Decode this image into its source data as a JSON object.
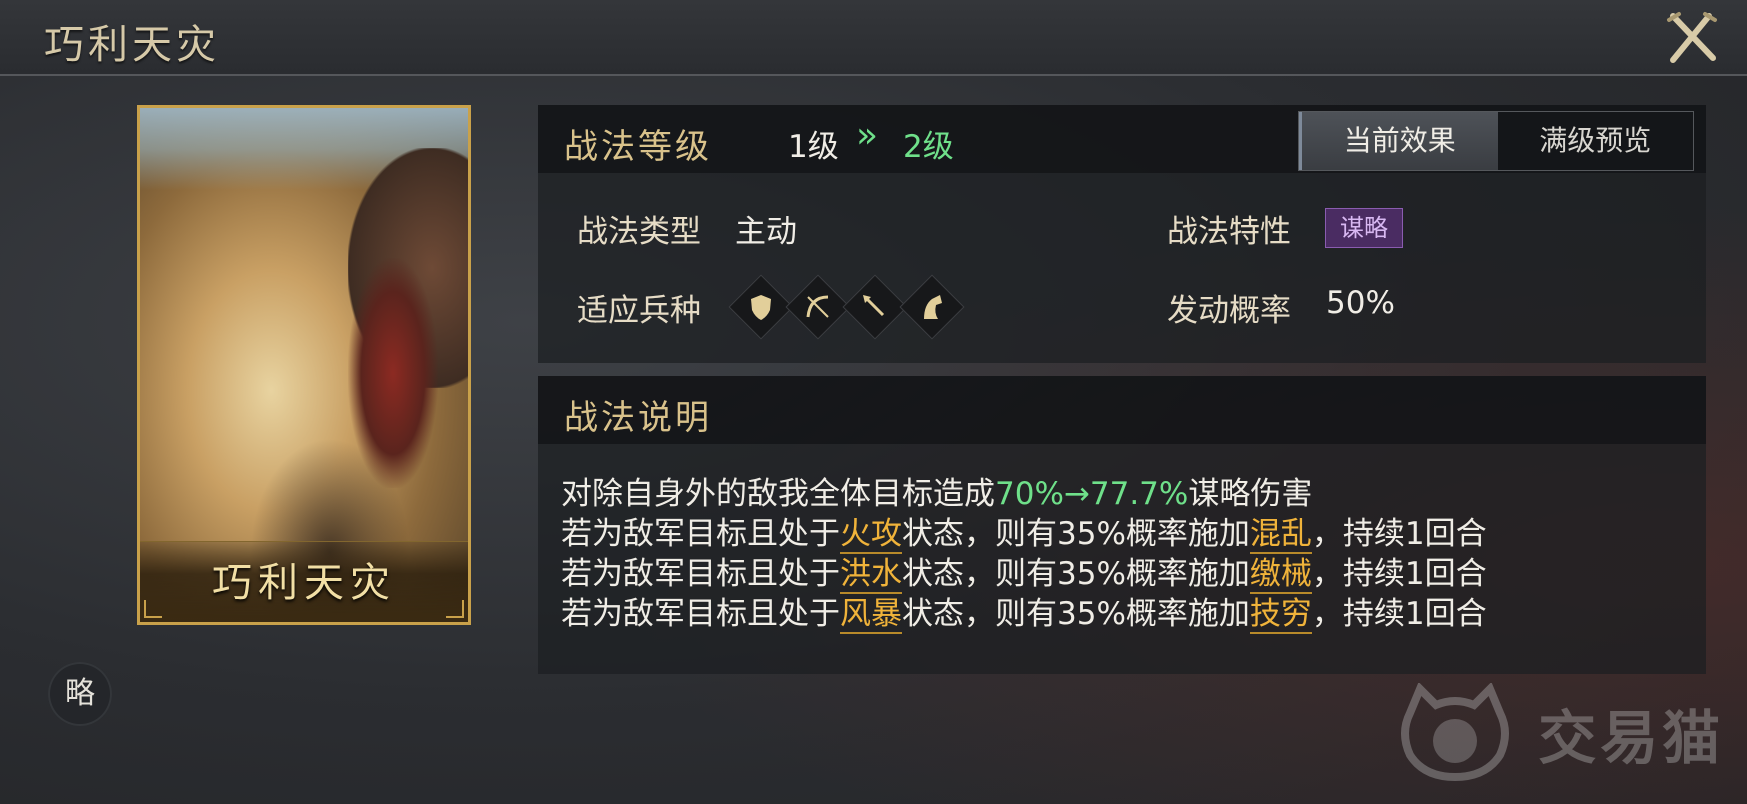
{
  "header": {
    "title": "巧利天灾"
  },
  "card": {
    "name": "巧利天灾"
  },
  "badge": {
    "text": "略"
  },
  "level_panel": {
    "title": "战法等级",
    "current_level": "1级",
    "arrow": "»",
    "next_level": "2级",
    "tabs": [
      {
        "label": "当前效果",
        "active": true
      },
      {
        "label": "满级预览",
        "active": false
      }
    ]
  },
  "info": {
    "type_label": "战法类型",
    "type_value": "主动",
    "trait_label": "战法特性",
    "trait_value": "谋略",
    "troop_label": "适应兵种",
    "troops": [
      "shield-icon",
      "bow-icon",
      "spear-icon",
      "horse-icon"
    ],
    "rate_label": "发动概率",
    "rate_value": "50%"
  },
  "description": {
    "title": "战法说明",
    "line1": {
      "prefix": "对除自身外的敌我全体目标造成",
      "value": "70%→77.7%",
      "suffix": "谋略伤害"
    },
    "lines": [
      {
        "prefix": "若为敌军目标且处于",
        "state": "火攻",
        "middle": "状态，则有35%概率施加",
        "effect": "混乱",
        "suffix": "，持续1回合"
      },
      {
        "prefix": "若为敌军目标且处于",
        "state": "洪水",
        "middle": "状态，则有35%概率施加",
        "effect": "缴械",
        "suffix": "，持续1回合"
      },
      {
        "prefix": "若为敌军目标且处于",
        "state": "风暴",
        "middle": "状态，则有35%概率施加",
        "effect": "技穷",
        "suffix": "，持续1回合"
      }
    ]
  },
  "watermark": {
    "text": "交易猫"
  },
  "colors": {
    "accent_gold": "#d9c28b",
    "highlight_green": "#6fe08a",
    "highlight_orange": "#f0b33a",
    "trait_purple": "#4a2c62"
  }
}
